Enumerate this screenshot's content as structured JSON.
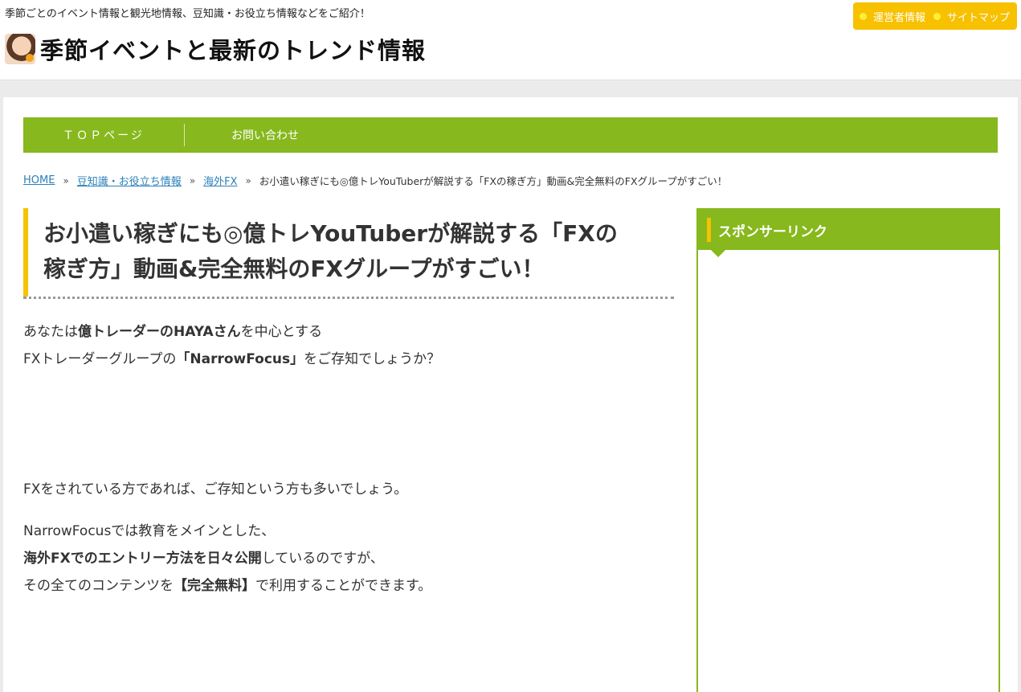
{
  "header": {
    "tagline": "季節ごとのイベント情報と観光地情報、豆知識・お役立ち情報などをご紹介！",
    "site_title": "季節イベントと最新のトレンド情報",
    "links": [
      "運営者情報",
      "サイトマップ"
    ]
  },
  "nav": {
    "items": [
      "ＴＯＰページ",
      "お問い合わせ"
    ]
  },
  "breadcrumb": {
    "home": "HOME",
    "category": "豆知識・お役立ち情報",
    "subcategory": "海外FX",
    "separator": "»",
    "current": "お小遣い稼ぎにも◎億トレYouTuberが解説する「FXの稼ぎ方」動画&完全無料のFXグループがすごい！"
  },
  "article": {
    "title_line1": "お小遣い稼ぎにも◎億トレYouTuberが解説する「FXの",
    "title_line2": "稼ぎ方」動画&完全無料のFXグループがすごい！",
    "p1_a": "あなたは",
    "p1_b": "億トレーダーのHAYAさん",
    "p1_c": "を中心とする",
    "p1_d": "FXトレーダーグループの",
    "p1_e": "「NarrowFocus」",
    "p1_f": "をご存知でしょうか？",
    "p2": "FXをされている方であれば、ご存知という方も多いでしょう。",
    "p3_a": "NarrowFocusでは教育をメインとした、",
    "p3_b": "海外FXでのエントリー方法を日々公開",
    "p3_c": "しているのですが、",
    "p3_d": "その全てのコンテンツを",
    "p3_e": "【完全無料】",
    "p3_f": "で利用することができます。"
  },
  "sidebar": {
    "title": "スポンサーリンク"
  },
  "colors": {
    "accent_green": "#87b81d",
    "accent_yellow": "#f5c300",
    "link_blue": "#2a80b9"
  }
}
